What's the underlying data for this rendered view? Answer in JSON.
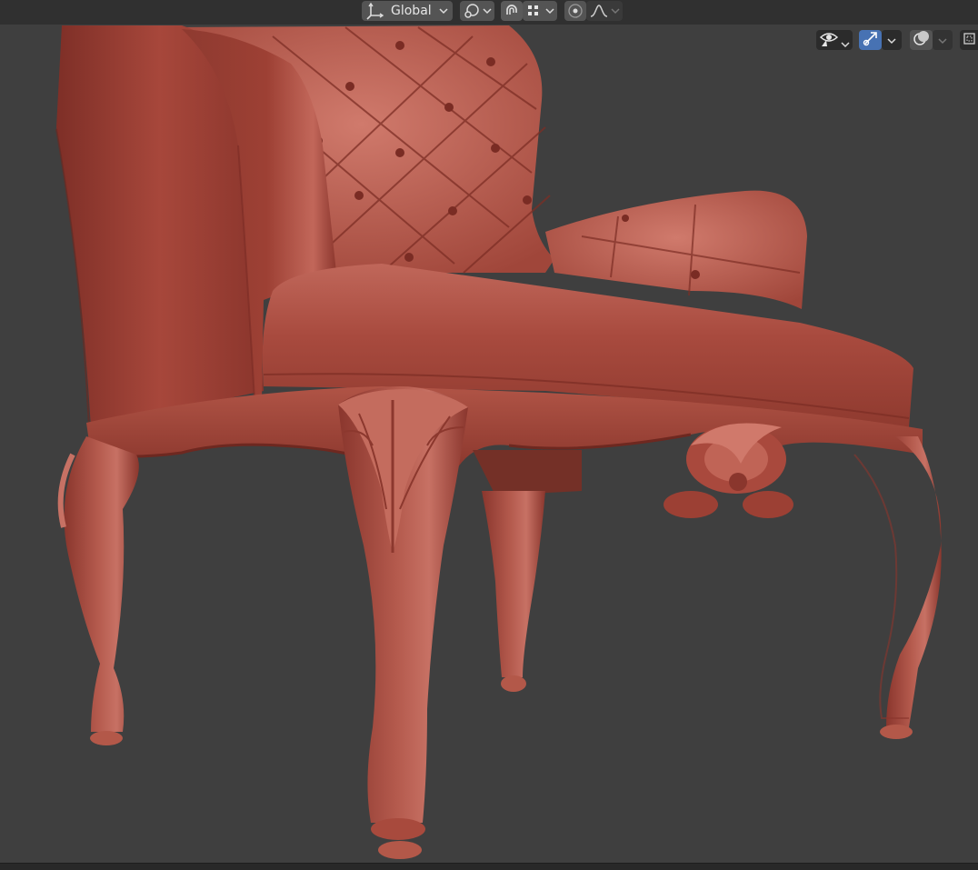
{
  "header": {
    "transform_orientation": {
      "label": "Global",
      "icon": "transform-orientation-icon"
    },
    "pivot_icon": "pivot-point-icon",
    "snap_icon": "snap-magnet-icon",
    "snap_target_icon": "snap-increment-grid-icon",
    "proportional_editing_icon": "proportional-editing-icon",
    "falloff_icon": "falloff-curve-icon"
  },
  "viewport_overlays": {
    "visibility_icon": "eye-visibility-icon",
    "gizmo_icon": "gizmo-toggle-icon",
    "overlay_icon": "overlays-icon",
    "xray_icon": "xray-toggle-icon"
  },
  "viewport": {
    "subject": "chair-model",
    "background_color": "#3f3f3f",
    "model_color": "#a8463b"
  },
  "colors": {
    "header_bg": "#303030",
    "button_bg": "#545454",
    "active_blue": "#4772b3"
  }
}
